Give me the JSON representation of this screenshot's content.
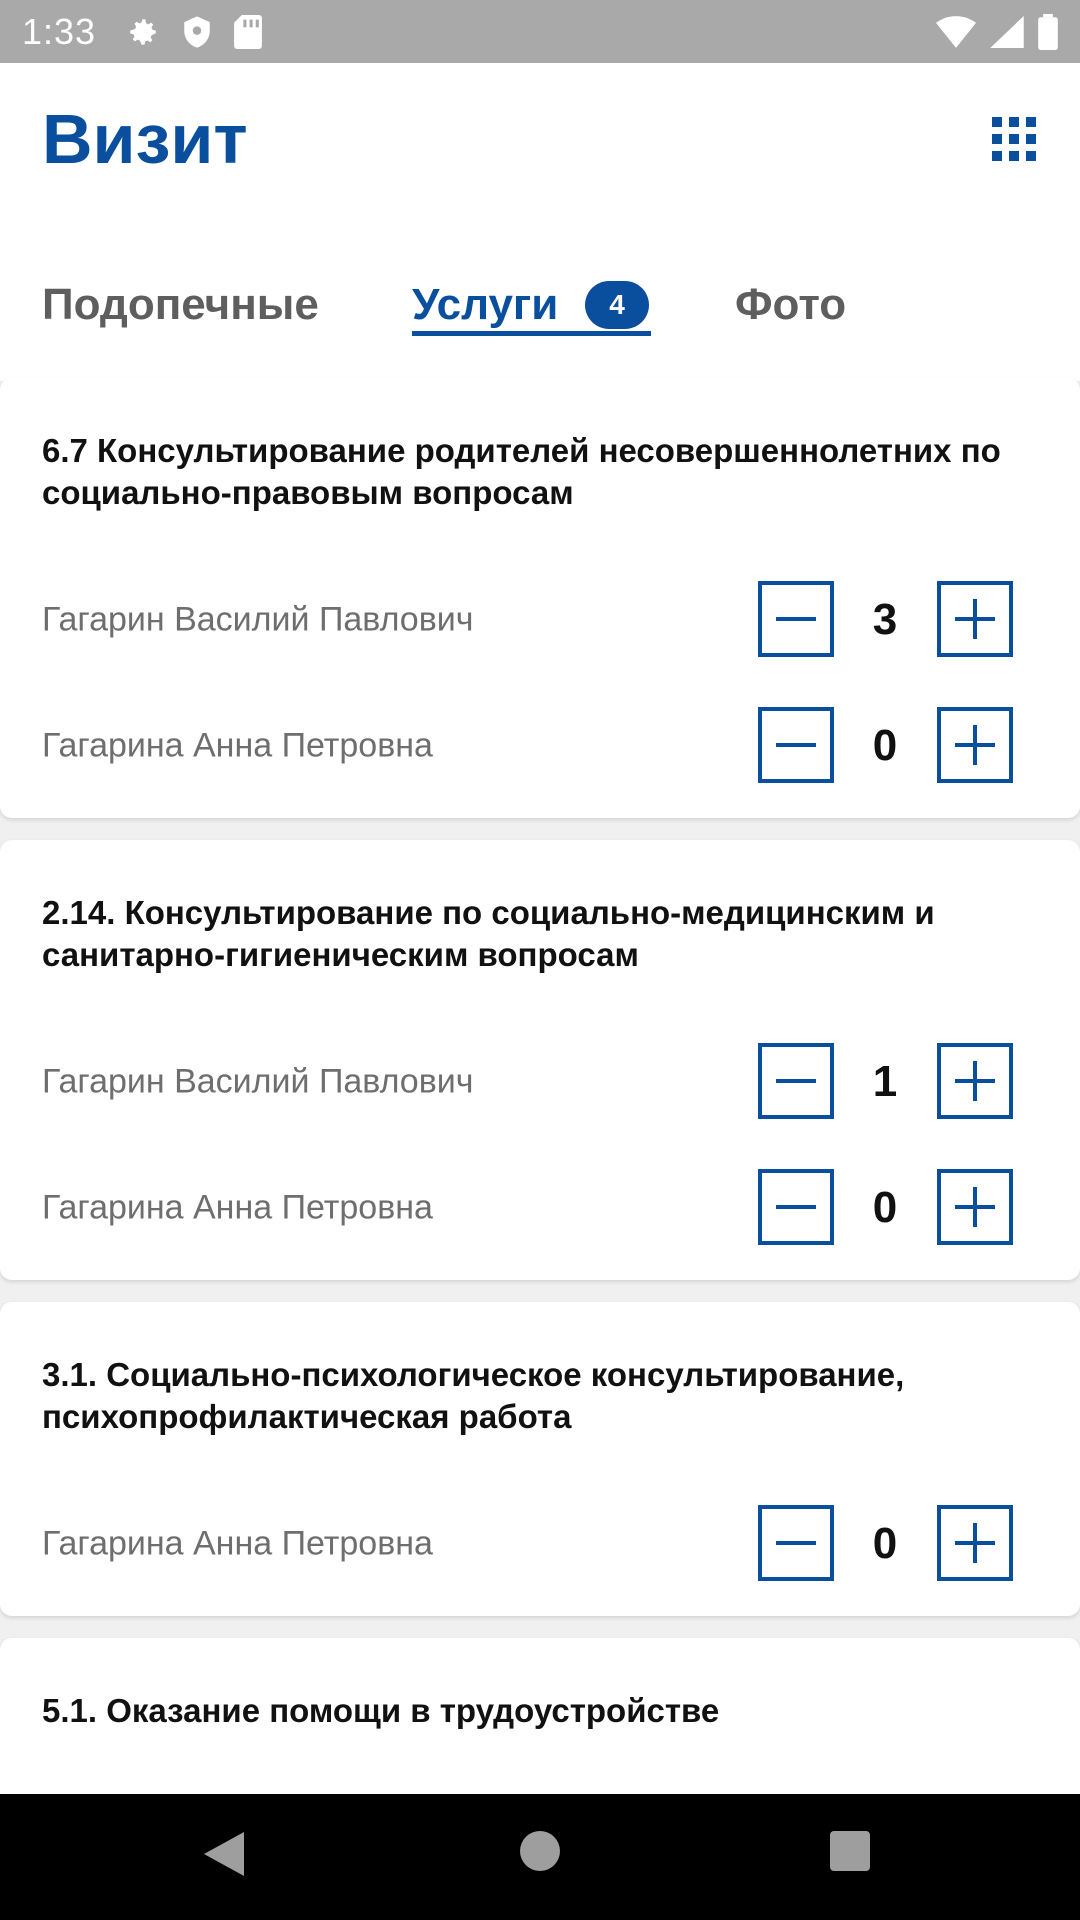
{
  "status_bar": {
    "time": "1:33",
    "left_icons": [
      "gear-icon",
      "shield-icon",
      "sd-card-icon"
    ],
    "right_icons": [
      "wifi-icon",
      "signal-icon",
      "battery-icon"
    ]
  },
  "header": {
    "title": "Визит",
    "menu_icon": "grid-icon"
  },
  "tabs": [
    {
      "label": "Подопечные",
      "active": false
    },
    {
      "label": "Услуги",
      "active": true,
      "badge": "4"
    },
    {
      "label": "Фото",
      "active": false
    }
  ],
  "services": [
    {
      "title": "6.7 Консультирование родителей несовершеннолетних по социально-правовым вопросам",
      "persons": [
        {
          "name": "Гагарин Василий Павлович",
          "count": "3"
        },
        {
          "name": "Гагарина Анна Петровна",
          "count": "0"
        }
      ]
    },
    {
      "title": "2.14. Консультирование по социально-медицинским и санитарно-гигиеническим вопросам",
      "persons": [
        {
          "name": "Гагарин Василий Павлович",
          "count": "1"
        },
        {
          "name": "Гагарина Анна Петровна",
          "count": "0"
        }
      ]
    },
    {
      "title": "3.1. Социально-психологическое консультирование, психопрофилактическая работа",
      "persons": [
        {
          "name": "Гагарина Анна Петровна",
          "count": "0"
        }
      ]
    },
    {
      "title": "5.1. Оказание помощи в трудоустройстве",
      "persons": []
    }
  ],
  "nav_bar": {
    "icons": [
      "back-icon",
      "home-icon",
      "recents-icon"
    ]
  },
  "colors": {
    "accent": "#0a4f9e",
    "status_bar": "#a9a9a9",
    "text_muted": "#6e6e6e"
  }
}
